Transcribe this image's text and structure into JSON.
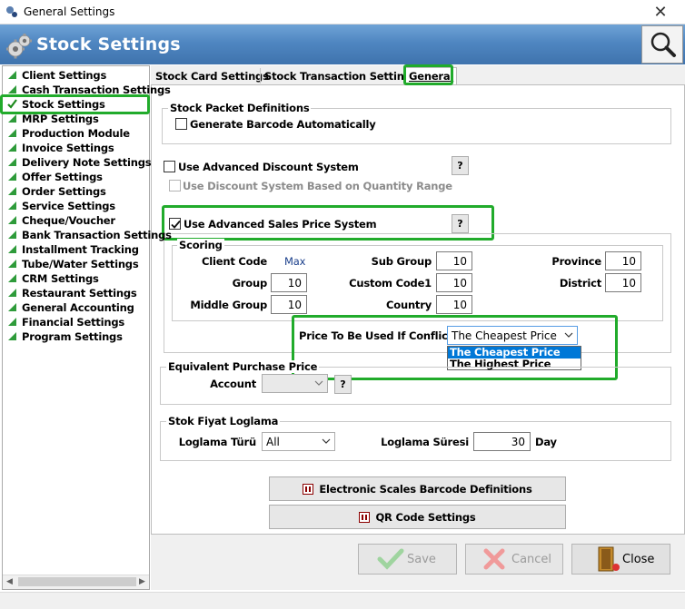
{
  "window": {
    "title": "General Settings",
    "close_glyph": "✕"
  },
  "header": {
    "title": "Stock Settings",
    "icon": "gears-icon",
    "search_icon": "magnifier-icon"
  },
  "sidebar": {
    "items": [
      {
        "label": "Client Settings"
      },
      {
        "label": "Cash Transaction Settings"
      },
      {
        "label": "Stock Settings",
        "selected": true
      },
      {
        "label": "MRP Settings"
      },
      {
        "label": "Production Module"
      },
      {
        "label": "Invoice Settings"
      },
      {
        "label": "Delivery Note Settings"
      },
      {
        "label": "Offer Settings"
      },
      {
        "label": "Order Settings"
      },
      {
        "label": "Service Settings"
      },
      {
        "label": "Cheque/Voucher"
      },
      {
        "label": "Bank Transaction Settings"
      },
      {
        "label": "Installment Tracking"
      },
      {
        "label": "Tube/Water Settings"
      },
      {
        "label": "CRM Settings"
      },
      {
        "label": "Restaurant Settings"
      },
      {
        "label": "General Accounting"
      },
      {
        "label": "Financial Settings"
      },
      {
        "label": "Program Settings"
      }
    ]
  },
  "tabs": [
    {
      "label": "Stock Card Settings"
    },
    {
      "label": "Stock Transaction Settings"
    },
    {
      "label": "General",
      "active": true
    }
  ],
  "stock_packet": {
    "legend": "Stock Packet Definitions",
    "generate_barcode_label": "Generate Barcode Automatically",
    "generate_barcode_checked": false
  },
  "discount": {
    "label": "Use Advanced Discount System",
    "checked": false,
    "help": "?",
    "quantity_range_label": "Use Discount System Based on Quantity Range",
    "quantity_range_checked": false
  },
  "sales_price": {
    "label": "Use Advanced Sales Price System",
    "checked": true,
    "help": "?"
  },
  "scoring": {
    "legend": "Scoring",
    "client_code_label": "Client Code",
    "client_code_value": "Max",
    "group_label": "Group",
    "group_value": "10",
    "middle_group_label": "Middle Group",
    "middle_group_value": "10",
    "sub_group_label": "Sub Group",
    "sub_group_value": "10",
    "custom_code1_label": "Custom Code1",
    "custom_code1_value": "10",
    "country_label": "Country",
    "country_value": "10",
    "province_label": "Province",
    "province_value": "10",
    "district_label": "District",
    "district_value": "10"
  },
  "conflict": {
    "label": "Price To Be Used If Conflicts",
    "selected": "The Cheapest Price",
    "options": [
      "The Cheapest Price",
      "The Highest Price"
    ]
  },
  "equivalent": {
    "legend": "Equivalent Purchase Price",
    "account_label": "Account",
    "account_value": "",
    "help": "?"
  },
  "log": {
    "legend": "Stok Fiyat Loglama",
    "type_label": "Loglama Türü",
    "type_value": "All",
    "duration_label": "Loglama Süresi",
    "duration_value": "30",
    "duration_unit": "Day"
  },
  "buttons": {
    "scales": "Electronic Scales Barcode Definitions",
    "qr": "QR Code Settings",
    "save": "Save",
    "cancel": "Cancel",
    "close": "Close"
  },
  "colors": {
    "header_blue": "#4f86c1",
    "highlight_green": "#21ab2b",
    "selection_blue": "#0078d7",
    "value_blue": "#1b3f8b"
  }
}
